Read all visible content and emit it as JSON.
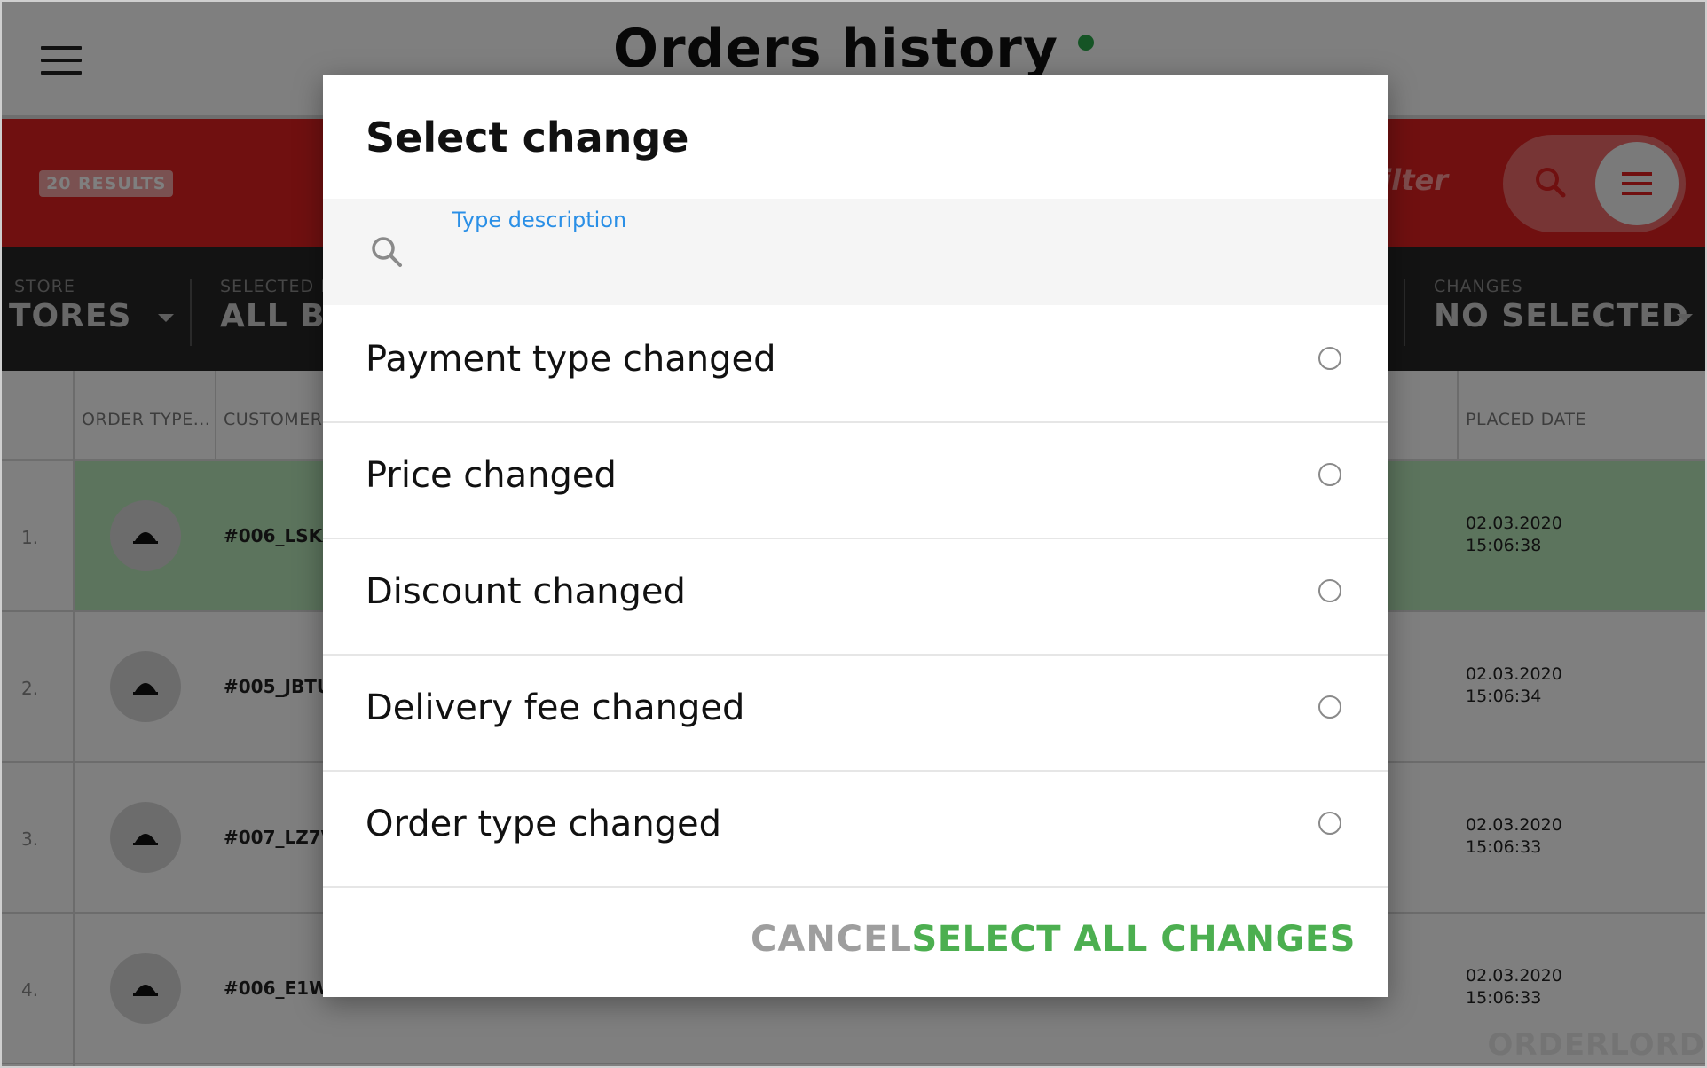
{
  "header": {
    "title": "Orders history"
  },
  "toolbar": {
    "results": "20 RESULTS",
    "filter_text": "d filter"
  },
  "filters": {
    "store": {
      "label": "STORE",
      "value": "TORES"
    },
    "brand": {
      "label": "SELECTED B",
      "value": "ALL BR"
    },
    "changes": {
      "label": "CHANGES",
      "value": "NO SELECTED"
    }
  },
  "table": {
    "columns": [
      "ORDER TYPE...",
      "CUSTOMER",
      "PLACED DATE"
    ],
    "rows": [
      {
        "num": "1.",
        "order": "#006_LSKA",
        "date": "02.03.2020",
        "time": "15:06:38"
      },
      {
        "num": "2.",
        "order": "#005_JBTU",
        "date": "02.03.2020",
        "time": "15:06:34"
      },
      {
        "num": "3.",
        "order": "#007_LZ7V",
        "date": "02.03.2020",
        "time": "15:06:33"
      },
      {
        "num": "4.",
        "order": "#006_E1W",
        "date": "02.03.2020",
        "time": "15:06:33"
      }
    ]
  },
  "brand": "ORDERLORD",
  "dialog": {
    "title": "Select change",
    "search_label": "Type description",
    "options": [
      "Payment type changed",
      "Price changed",
      "Discount changed",
      "Delivery fee changed",
      "Order type changed"
    ],
    "cancel": "CANCEL",
    "select_all": "SELECT ALL CHANGES"
  },
  "colors": {
    "primary_red": "#e02020",
    "accent_green": "#4caf50",
    "link_blue": "#2a8fe6"
  }
}
